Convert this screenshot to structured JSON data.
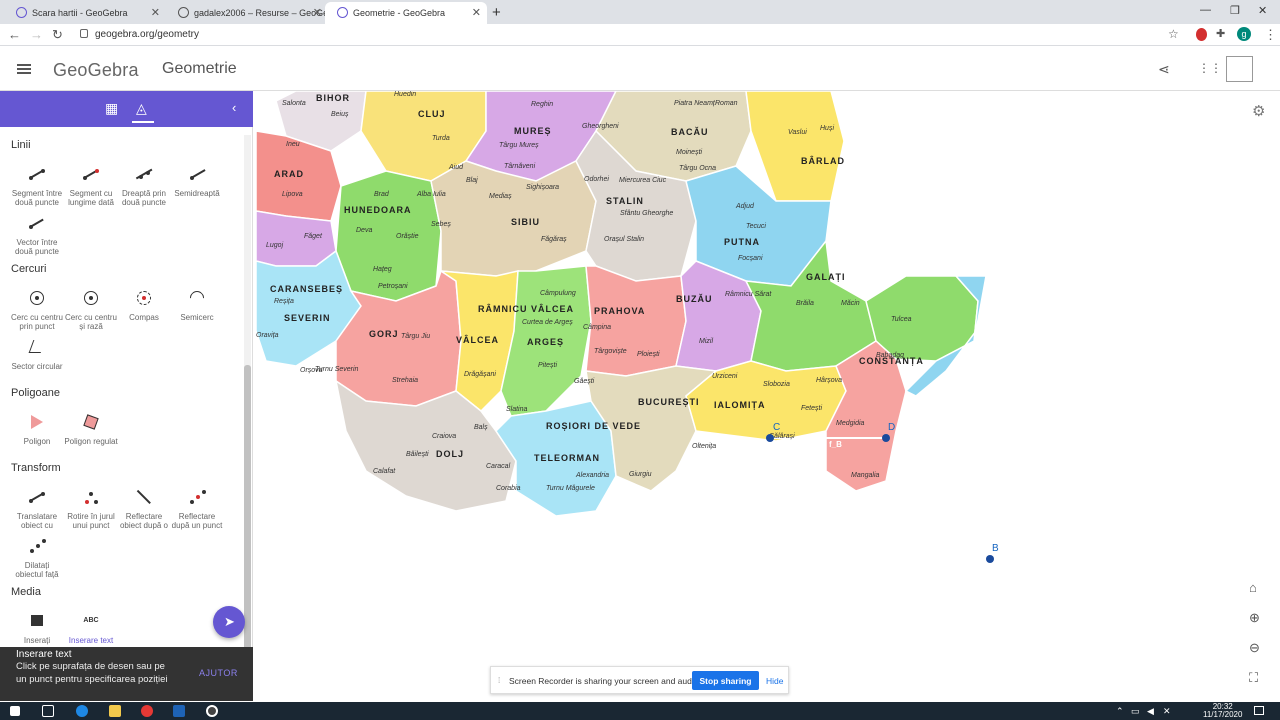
{
  "browser": {
    "tabs": [
      {
        "title": "Scara hartii - GeoGebra",
        "active": false
      },
      {
        "title": "gadalex2006 – Resurse – GeoGebra",
        "active": false
      },
      {
        "title": "Geometrie - GeoGebra",
        "active": true
      }
    ],
    "url": "geogebra.org/geometry",
    "profile_initial": "g"
  },
  "app": {
    "logo": "GeoGebra",
    "title": "Geometrie"
  },
  "toolbox": {
    "categories": [
      {
        "name": "Linii",
        "tools": [
          "Segment între două puncte",
          "Segment cu lungime dată",
          "Dreaptă prin două puncte",
          "Semidreaptă",
          "Vector între două puncte"
        ]
      },
      {
        "name": "Cercuri",
        "tools": [
          "Cerc cu centru prin punct",
          "Cerc cu centru și rază",
          "Compas",
          "Semicerc",
          "Sector circular"
        ]
      },
      {
        "name": "Poligoane",
        "tools": [
          "Poligon",
          "Poligon regulat"
        ]
      },
      {
        "name": "Transform",
        "tools": [
          "Translatare obiect cu",
          "Rotire în jurul unui punct",
          "Reflectare obiect după o",
          "Reflectare după un punct",
          "Dilatați obiectul față"
        ]
      },
      {
        "name": "Media",
        "tools": [
          "Inserați",
          "Inserare text"
        ]
      }
    ]
  },
  "snackbar": {
    "title": "Inserare text",
    "message": "Click pe suprafața de desen sau pe un punct pentru specificarea poziției",
    "help": "AJUTOR"
  },
  "canvas": {
    "points": [
      {
        "label": "C"
      },
      {
        "label": "D"
      },
      {
        "label": "B"
      }
    ],
    "segment_label": "f_B"
  },
  "map": {
    "counties": [
      "BIHOR",
      "CLUJ",
      "MUREȘ",
      "BACĂU",
      "BÂRLAD",
      "ARAD",
      "HUNEDOARA",
      "STALIN",
      "SIBIU",
      "PUTNA",
      "CARANSEBEȘ",
      "SEVERIN",
      "GALAȚI",
      "BUZĂU",
      "RÂMNICU VÂLCEA",
      "VÂLCEA",
      "ARGEȘ",
      "PRAHOVA",
      "GORJ",
      "DOLJ",
      "ROȘIORI DE VEDE",
      "TELEORMAN",
      "BUCUREȘTI",
      "IALOMIȚA",
      "CONSTANȚA"
    ],
    "cities": [
      "Salonta",
      "Beiuș",
      "Huedin",
      "Turda",
      "Aiud",
      "Reghin",
      "Târgu Mureș",
      "Gheorgheni",
      "Târnăveni",
      "Blaj",
      "Mediaș",
      "Sighișoara",
      "Odorhei",
      "Miercurea Ciuc",
      "Piatra Neamț",
      "Roman",
      "Moinești",
      "Târgu Ocna",
      "Vaslui",
      "Huși",
      "Ineu",
      "Lipova",
      "Brad",
      "Alba Iulia",
      "Sebeș",
      "Făgăraș",
      "Sfântu Gheorghe",
      "Orașul Stalin",
      "Adjud",
      "Tecuci",
      "Focșani",
      "Lugoj",
      "Făget",
      "Deva",
      "Orăștie",
      "Hațeg",
      "Petroșani",
      "Reșița",
      "Oravița",
      "Câmpulung",
      "Curtea de Argeș",
      "Pitești",
      "Găești",
      "Câmpina",
      "Târgoviște",
      "Ploiești",
      "Râmnicu Sărat",
      "Mizil",
      "Brăila",
      "Măcin",
      "Tulcea",
      "Babadag",
      "Medgidia",
      "Mangalia",
      "Călărași",
      "Urziceni",
      "Slobozia",
      "Fetești",
      "Hârșova",
      "Oltenița",
      "Giurgiu",
      "Alexandria",
      "Turnu Măgurele",
      "Corabia",
      "Caracal",
      "Slatina",
      "Drăgășani",
      "Băilești",
      "Calafat",
      "Craiova",
      "Balș",
      "Turnu Severin",
      "Strehaia",
      "Orșova",
      "Târgu Jiu"
    ]
  },
  "recorder": {
    "message": "Screen Recorder is sharing your screen and audio.",
    "stop": "Stop sharing",
    "hide": "Hide"
  },
  "taskbar": {
    "time": "20:32",
    "date": "11/17/2020"
  }
}
